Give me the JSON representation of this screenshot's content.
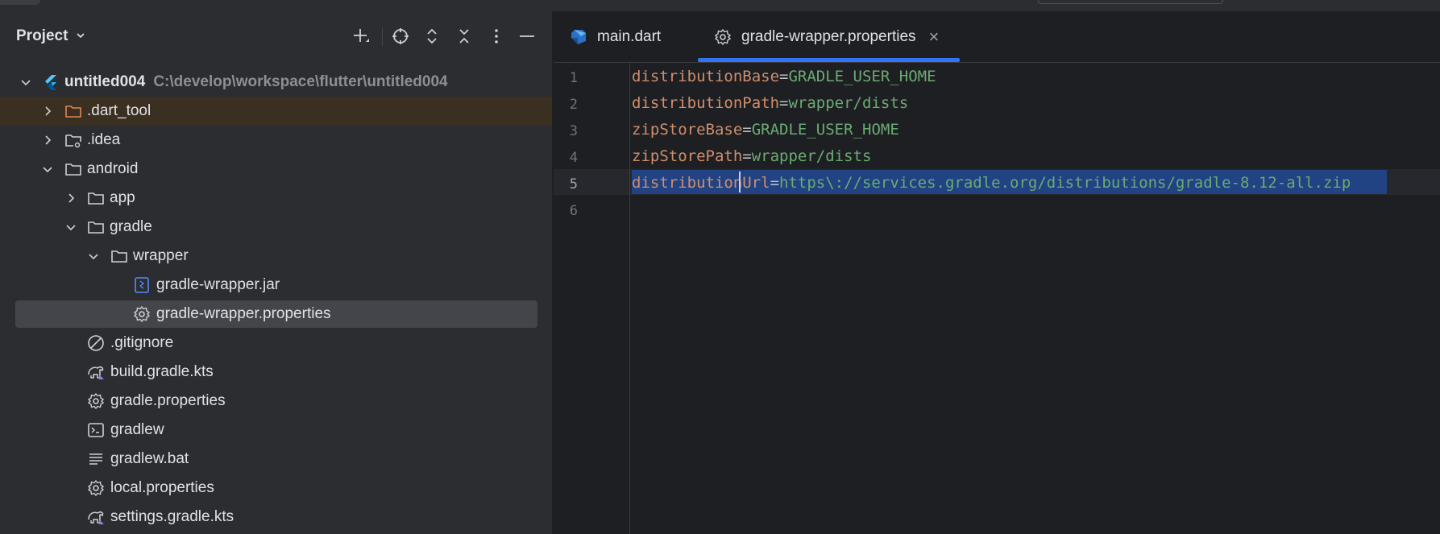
{
  "project_panel": {
    "title": "Project",
    "toolbar": {
      "new_icon": "plus-icon",
      "locate_icon": "crosshair-icon",
      "expand_icon": "expand-all-icon",
      "collapse_icon": "collapse-all-icon",
      "options_icon": "more-vertical-icon",
      "hide_icon": "minimize-icon"
    },
    "tree": {
      "root": {
        "name": "untitled004",
        "path": "C:\\develop\\workspace\\flutter\\untitled004"
      },
      "items": [
        {
          "label": ".dart_tool"
        },
        {
          "label": ".idea"
        },
        {
          "label": "android"
        },
        {
          "label": "app"
        },
        {
          "label": "gradle"
        },
        {
          "label": "wrapper"
        },
        {
          "label": "gradle-wrapper.jar"
        },
        {
          "label": "gradle-wrapper.properties"
        },
        {
          "label": ".gitignore"
        },
        {
          "label": "build.gradle.kts"
        },
        {
          "label": "gradle.properties"
        },
        {
          "label": "gradlew"
        },
        {
          "label": "gradlew.bat"
        },
        {
          "label": "local.properties"
        },
        {
          "label": "settings.gradle.kts"
        }
      ]
    }
  },
  "editor": {
    "tabs": [
      {
        "label": "main.dart",
        "icon": "dart-icon"
      },
      {
        "label": "gradle-wrapper.properties",
        "icon": "gear-icon",
        "close": "×"
      }
    ],
    "line_numbers": [
      "1",
      "2",
      "3",
      "4",
      "5",
      "6"
    ],
    "lines": [
      {
        "key": "distributionBase",
        "eq": "=",
        "value": "GRADLE_USER_HOME"
      },
      {
        "key": "distributionPath",
        "eq": "=",
        "value": "wrapper/dists"
      },
      {
        "key": "zipStoreBase",
        "eq": "=",
        "value": "GRADLE_USER_HOME"
      },
      {
        "key": "zipStorePath",
        "eq": "=",
        "value": "wrapper/dists"
      },
      {
        "key": "distributionUrl",
        "eq": "=",
        "value": "https\\://services.gradle.org/distributions/gradle-8.12-all.zip"
      }
    ]
  },
  "colors": {
    "accent": "#3574f0",
    "selection": "#214283",
    "key": "#cf8e6d",
    "value": "#6aab73"
  }
}
